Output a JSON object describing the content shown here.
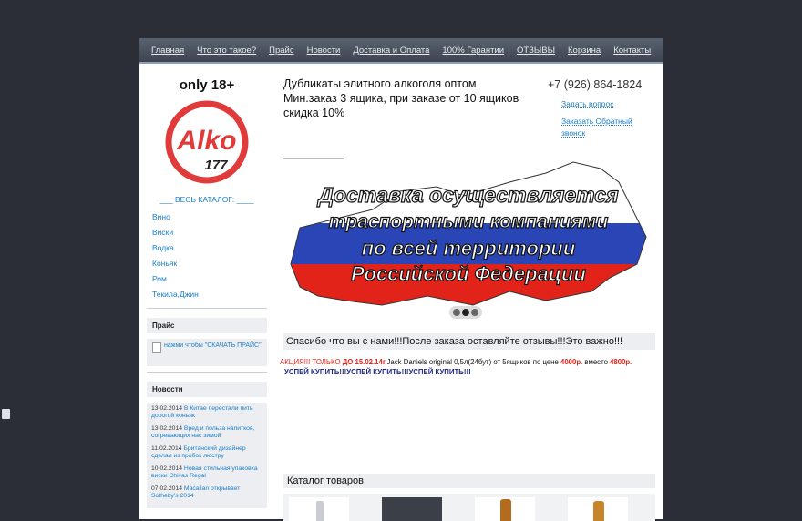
{
  "nav": {
    "items": [
      "Главная",
      "Что это такое?",
      "Прайс",
      "Новости",
      "Доставка и Оплата",
      "100% Гарантии",
      "ОТЗЫВЫ",
      "Корзина",
      "Контакты"
    ]
  },
  "left": {
    "age": "only 18+",
    "logo_text": "Alko",
    "logo_num": "177",
    "catalog_head": "___ ВЕСЬ КАТАЛОГ: ____",
    "categories": [
      "Вино",
      "Виски",
      "Водка",
      "Коньяк",
      "Ром",
      "Текила,Джин"
    ],
    "price_head": "Прайс",
    "price_link": "нажми чтобы \"СКАЧАТЬ ПРАЙС\"",
    "news_head": "Новости",
    "news": [
      {
        "date": "13.02.2014",
        "text": "В Китае перестали пить дорогой коньяк"
      },
      {
        "date": "13.02.2014",
        "text": "Вред и польза напитков, согревающих нас зимой"
      },
      {
        "date": "11.02.2014",
        "text": "Британский дизайнер сделал из пробок люстру"
      },
      {
        "date": "10.02.2014",
        "text": "Новая стильная упаковка виски Chivas Regal"
      },
      {
        "date": "07.02.2014",
        "text": "Macallan открывает Sotheby's 2014"
      }
    ]
  },
  "main": {
    "slogan_1": "Дубликаты элитного алкоголя оптом",
    "slogan_2": "Мин.заказ 3 ящика, при заказе от 10 ящиков скидка 10%",
    "phone": "+7 (926) 864-1824",
    "ask_link": "Задать вопрос",
    "callback_link": "Заказать Обратный звонок",
    "banner_lines": [
      "Доставка осуществляется",
      "траспортными компаниями",
      "по всей территории",
      "Российской Федерации"
    ],
    "thanks": "Спасибо что вы с нами!!!После заказа оставляйте отзывы!!!Это важно!!!",
    "promo_a": "АКЦИЯ!!! ТОЛЬКО ",
    "promo_b": "ДО 15.02.14г.",
    "promo_c": "Jack Daniels original 0,5л(24бут) от 5ящиков по цене ",
    "promo_d": "4000р.",
    "promo_e": " вместо ",
    "promo_f": "4800р.",
    "promo_hurry": "УСПЕЙ КУПИТЬ!!!УСПЕЙ КУПИТЬ!!!УСПЕЙ КУПИТЬ!!!",
    "catalog_title": "Каталог товаров"
  },
  "colors": {
    "accent": "#1a7fc8",
    "promo_red": "#e2231a",
    "logo_red": "#e03a3a"
  }
}
